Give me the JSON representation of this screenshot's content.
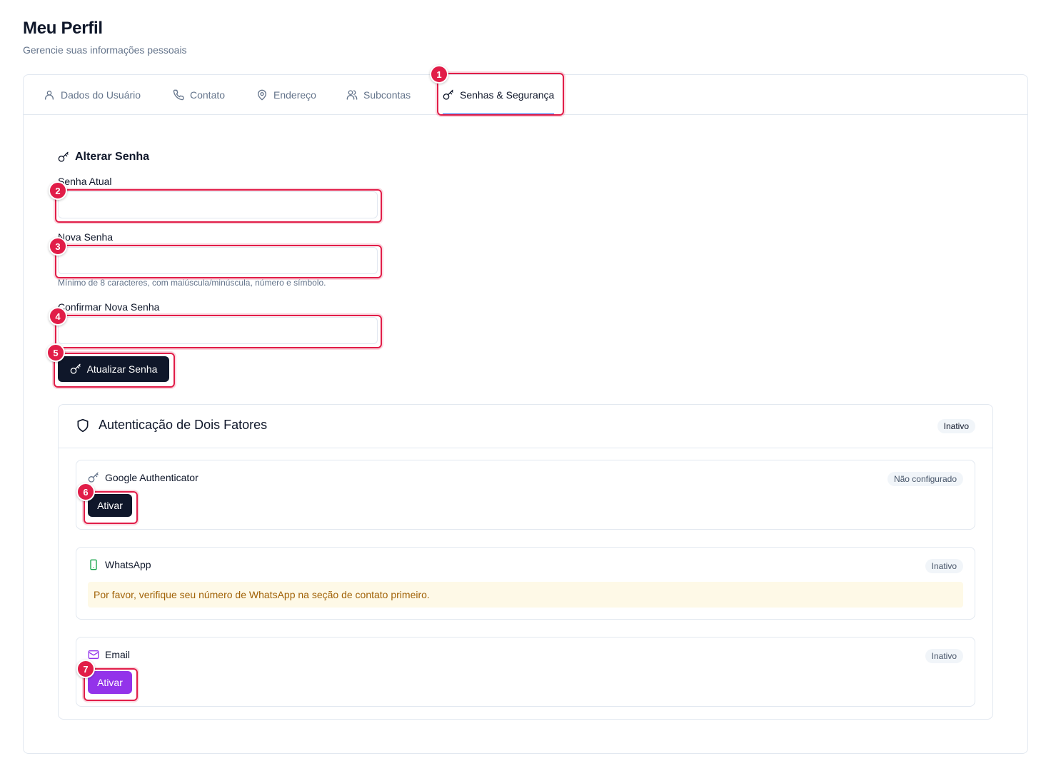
{
  "header": {
    "title": "Meu Perfil",
    "subtitle": "Gerencie suas informações pessoais"
  },
  "tabs": [
    {
      "label": "Dados do Usuário",
      "icon": "user-icon"
    },
    {
      "label": "Contato",
      "icon": "phone-icon"
    },
    {
      "label": "Endereço",
      "icon": "map-pin-icon"
    },
    {
      "label": "Subcontas",
      "icon": "users-icon"
    },
    {
      "label": "Senhas & Segurança",
      "icon": "key-icon",
      "active": true
    }
  ],
  "password": {
    "section_title": "Alterar Senha",
    "current_label": "Senha Atual",
    "current_value": "",
    "new_label": "Nova Senha",
    "new_value": "",
    "new_hint": "Mínimo de 8 caracteres, com maiúscula/minúscula, número e símbolo.",
    "confirm_label": "Confirmar Nova Senha",
    "confirm_value": "",
    "submit_label": "Atualizar Senha"
  },
  "two_factor": {
    "title": "Autenticação de Dois Fatores",
    "status": "Inativo",
    "methods": [
      {
        "name": "Google Authenticator",
        "status": "Não configurado",
        "action": "Ativar",
        "icon": "key-icon"
      },
      {
        "name": "WhatsApp",
        "status": "Inativo",
        "warning": "Por favor, verifique seu número de WhatsApp na seção de contato primeiro.",
        "icon": "smartphone-icon"
      },
      {
        "name": "Email",
        "status": "Inativo",
        "action": "Ativar",
        "icon": "mail-icon"
      }
    ]
  },
  "annotations": [
    "1",
    "2",
    "3",
    "4",
    "5",
    "6",
    "7"
  ],
  "colors": {
    "primary_dark": "#0f172a",
    "accent_blue": "#2563eb",
    "highlight": "#e11d48",
    "email_purple": "#9333ea",
    "whatsapp_green": "#16a34a",
    "warning_bg": "#fef9e7",
    "warning_text": "#a16207"
  }
}
